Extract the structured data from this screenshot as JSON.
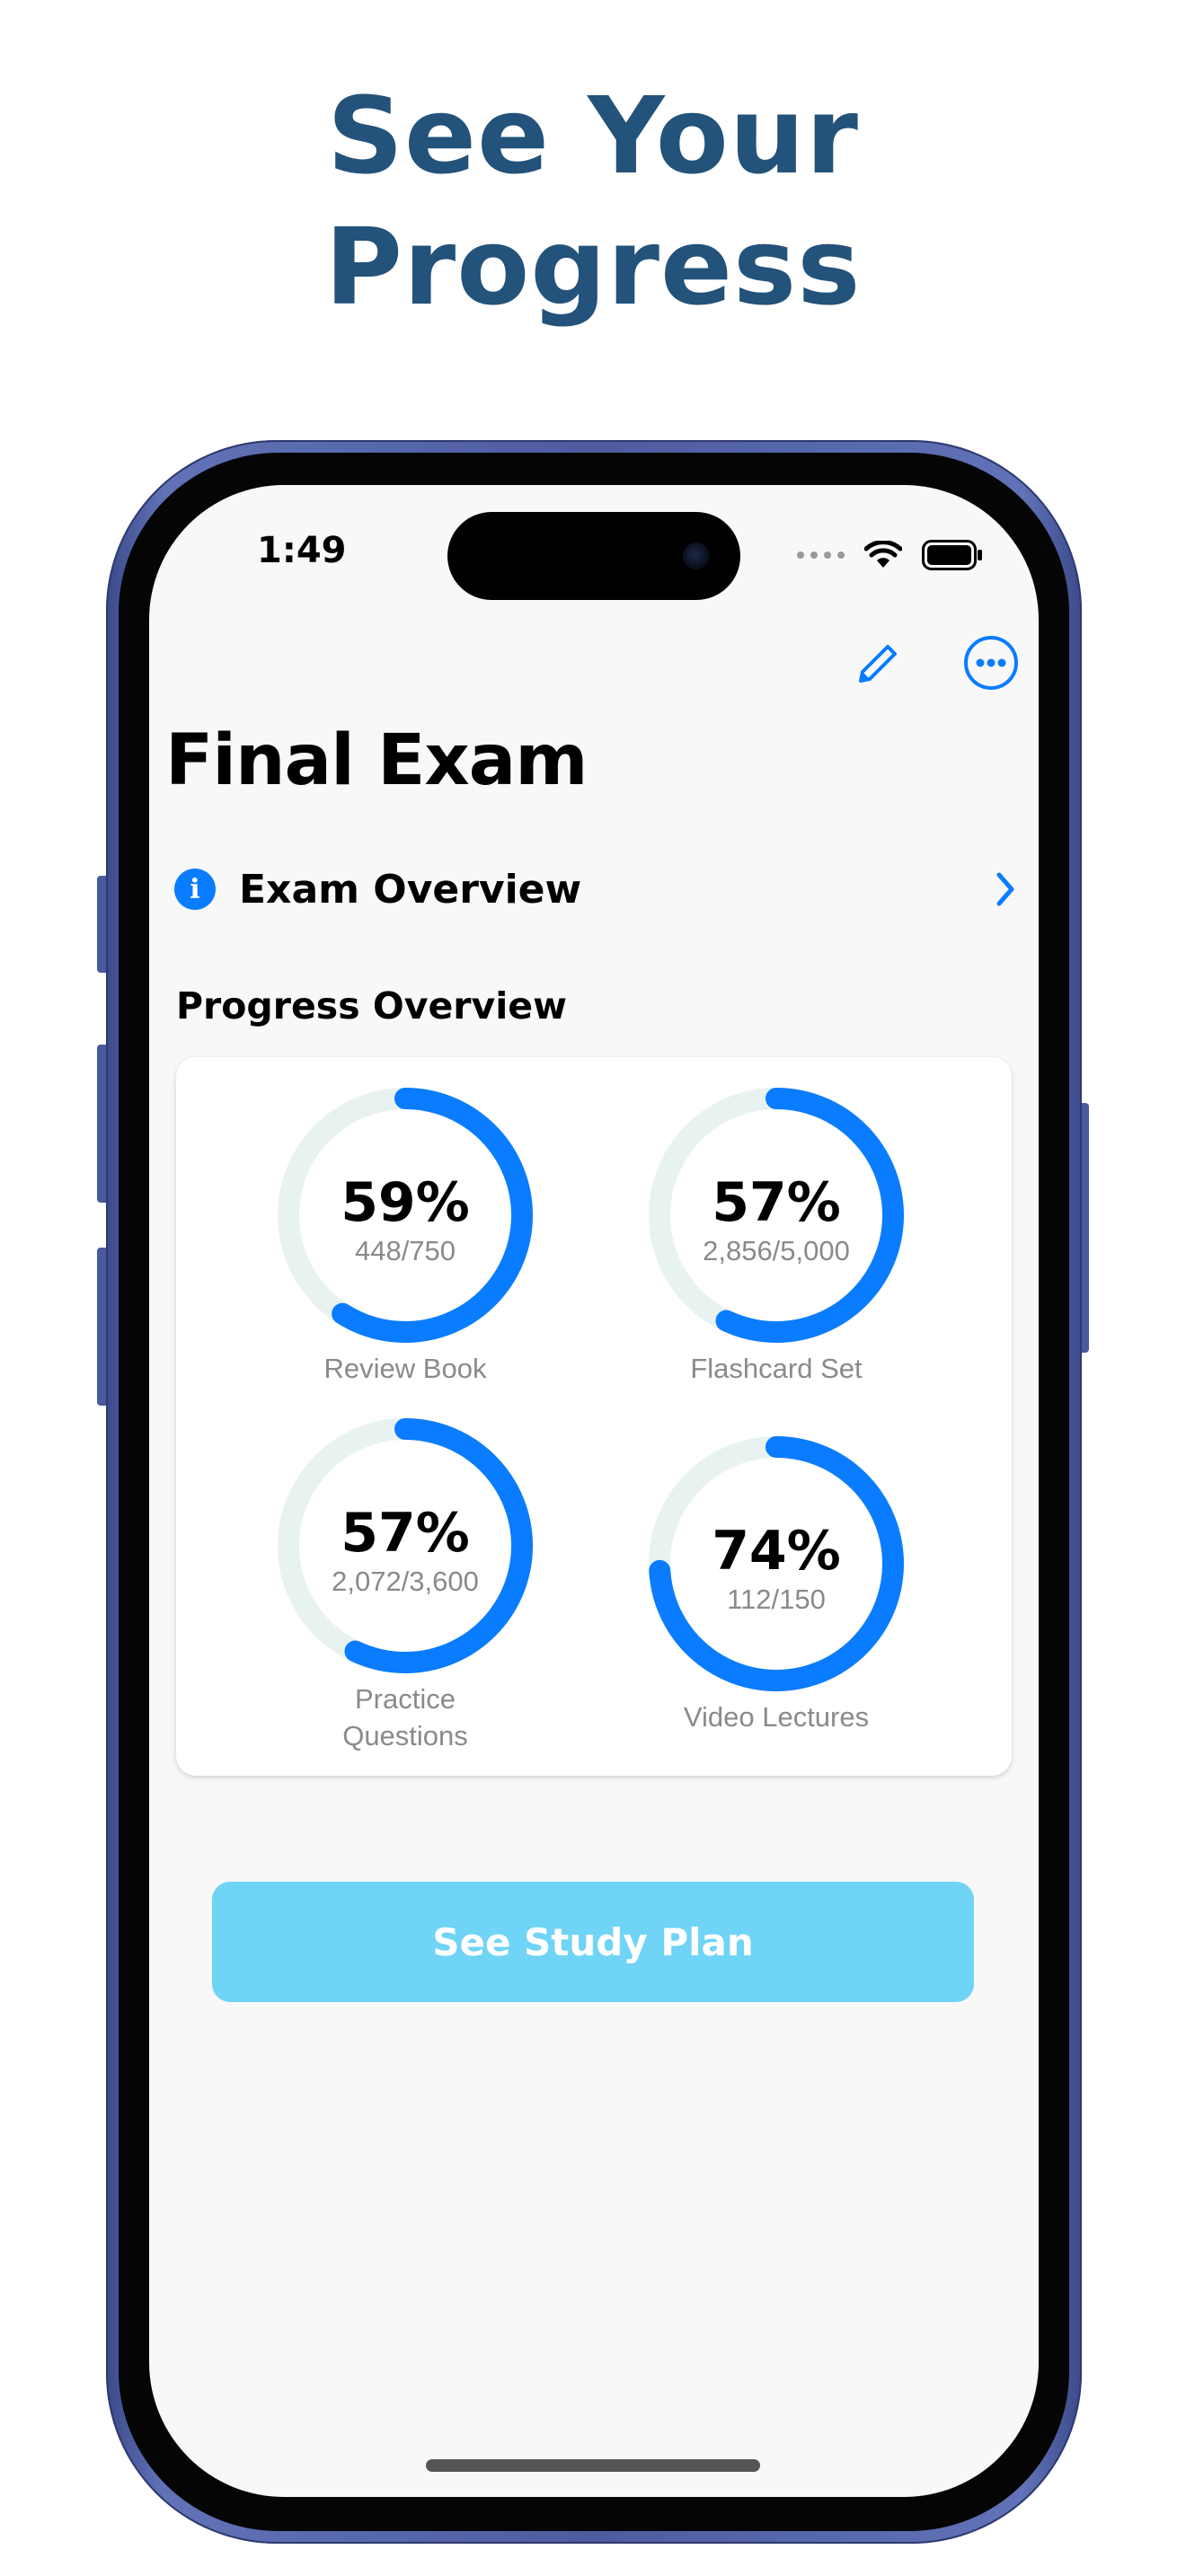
{
  "headline": {
    "line1": "See Your",
    "line2": "Progress"
  },
  "status_bar": {
    "time": "1:49"
  },
  "nav": {
    "edit_icon": "pencil-icon",
    "more_icon": "ellipsis-circle-icon"
  },
  "page_title": "Final Exam",
  "overview_link": {
    "label": "Exam Overview",
    "icon": "info-circle-icon"
  },
  "section_title": "Progress Overview",
  "progress_items": [
    {
      "percent": "59%",
      "count": "448/750",
      "label_line1": "Review Book",
      "label_line2": "",
      "fraction": 0.59
    },
    {
      "percent": "57%",
      "count": "2,856/5,000",
      "label_line1": "Flashcard Set",
      "label_line2": "",
      "fraction": 0.57
    },
    {
      "percent": "57%",
      "count": "2,072/3,600",
      "label_line1": "Practice",
      "label_line2": "Questions",
      "fraction": 0.57
    },
    {
      "percent": "74%",
      "count": "112/150",
      "label_line1": "Video Lectures",
      "label_line2": "",
      "fraction": 0.74
    }
  ],
  "study_plan_button": "See Study Plan",
  "colors": {
    "headline": "#23527a",
    "accent": "#0a7cff",
    "ring_track": "#e8f2f1",
    "button": "#6fd4f5"
  }
}
